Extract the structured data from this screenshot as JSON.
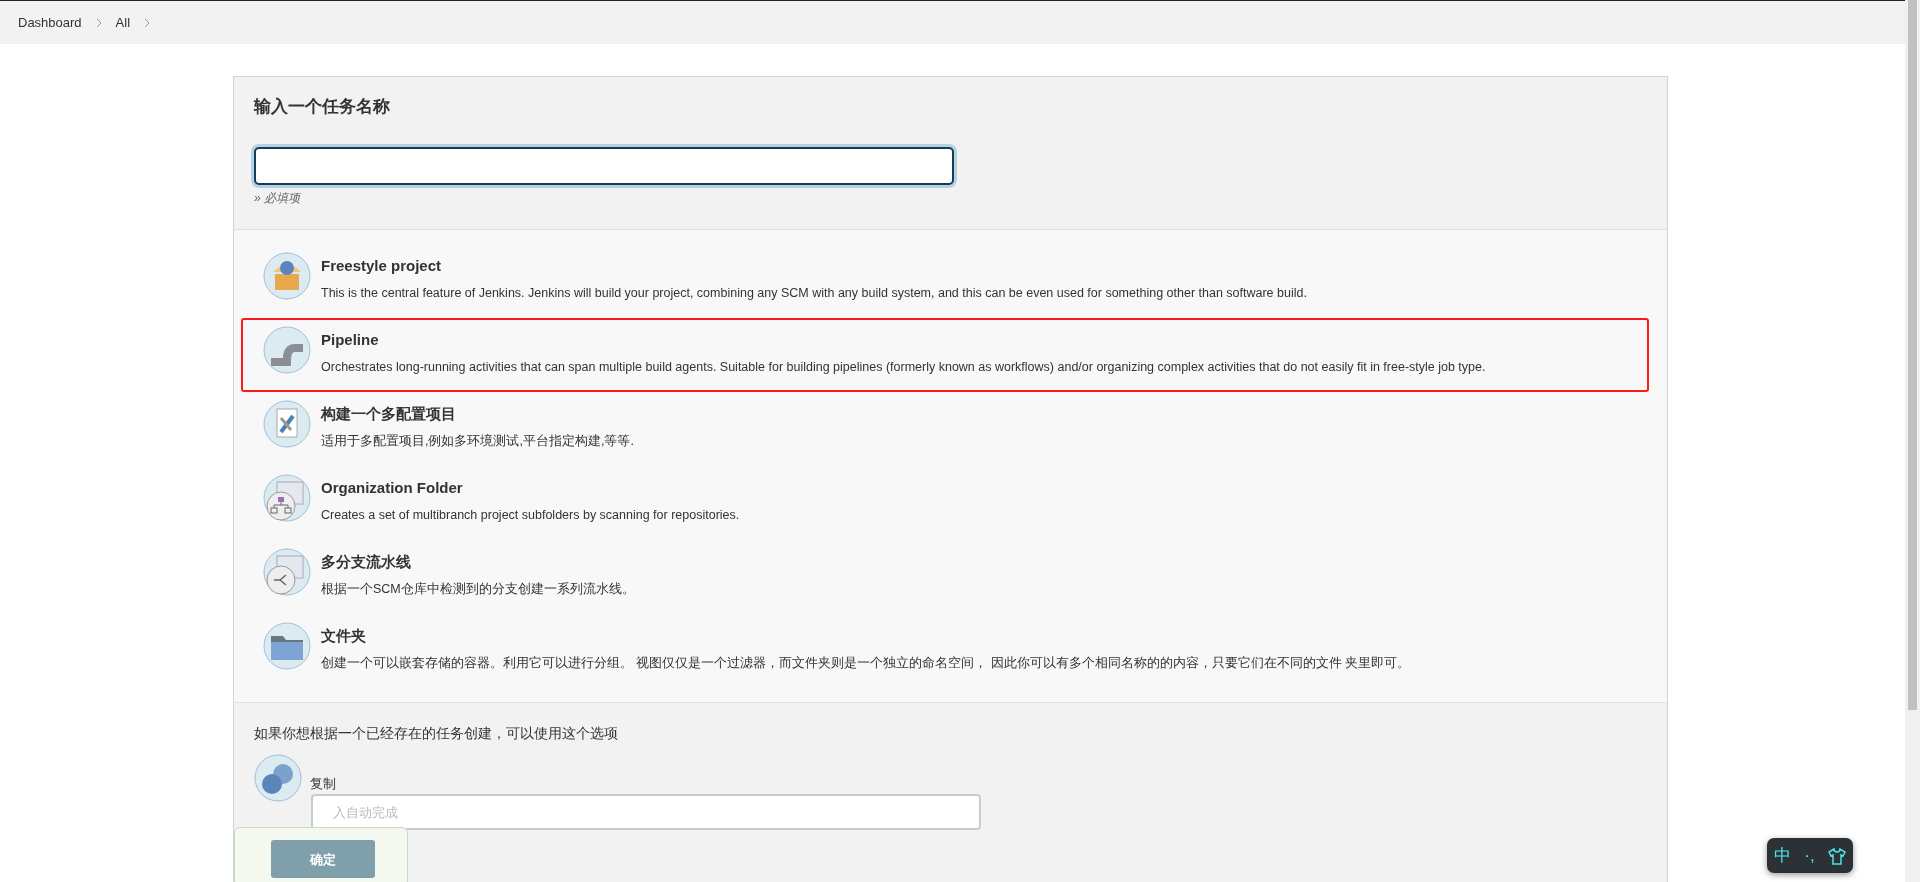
{
  "breadcrumbs": [
    {
      "label": "Dashboard"
    },
    {
      "label": "All"
    }
  ],
  "name_section": {
    "title": "输入一个任务名称",
    "hint": "» 必填项",
    "focused": true
  },
  "items": [
    {
      "kind": "box",
      "title": "Freestyle project",
      "description": "This is the central feature of Jenkins. Jenkins will build your project, combining any SCM with any build system, and this can be even used for something other than software build.",
      "highlighted": false
    },
    {
      "kind": "pipe",
      "title": "Pipeline",
      "description": "Orchestrates long-running activities that can span multiple build agents. Suitable for building pipelines (formerly known as workflows) and/or organizing complex activities that do not easily fit in free-style job type.",
      "highlighted": true
    },
    {
      "kind": "tools",
      "title": "构建一个多配置项目",
      "description": "适用于多配置项目,例如多环境测试,平台指定构建,等等.",
      "highlighted": false
    },
    {
      "kind": "org",
      "title": "Organization Folder",
      "description": "Creates a set of multibranch project subfolders by scanning for repositories.",
      "highlighted": false
    },
    {
      "kind": "branch",
      "title": "多分支流水线",
      "description": "根据一个SCM仓库中检测到的分支创建一系列流水线。",
      "highlighted": false
    },
    {
      "kind": "folder",
      "title": "文件夹",
      "description": "创建一个可以嵌套存储的容器。利用它可以进行分组。 视图仅仅是一个过滤器，而文件夹则是一个独立的命名空间， 因此你可以有多个相同名称的的内容，只要它们在不同的文件 夹里即可。",
      "highlighted": false
    }
  ],
  "copy_section": {
    "text": "如果你想根据一个已经存在的任务创建，可以使用这个选项",
    "label": "复制",
    "placeholder": "入自动完成"
  },
  "ok_button": {
    "label": "确定",
    "disabled": true
  },
  "ime": {
    "mode": "中",
    "punctuation": "·,"
  }
}
